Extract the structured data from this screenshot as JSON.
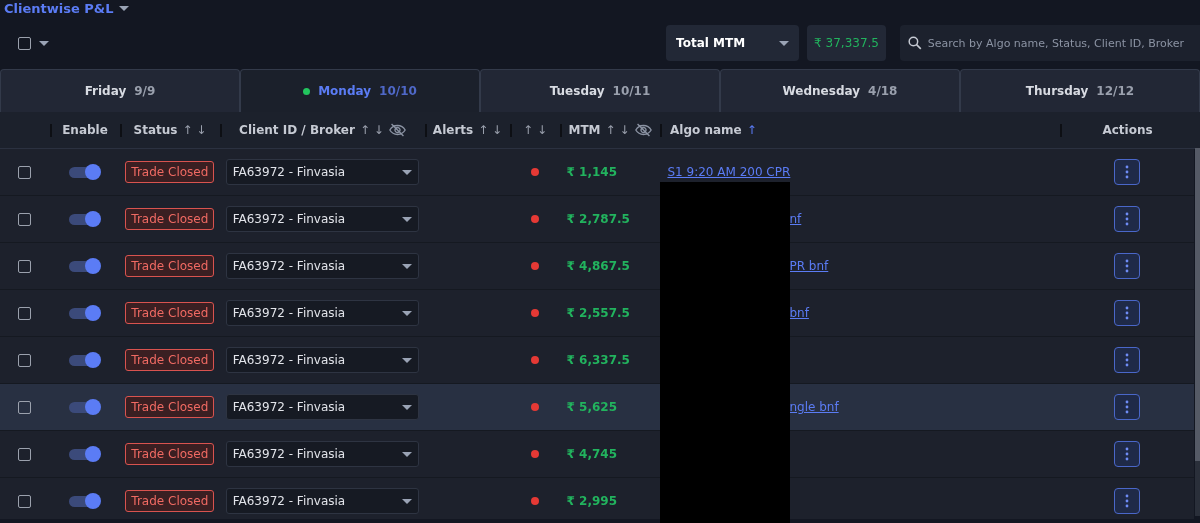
{
  "title": "Clientwise P&L",
  "select_all": {
    "checked": false
  },
  "metric_select": {
    "value": "Total MTM"
  },
  "total": "₹ 37,337.5",
  "search": {
    "placeholder": "Search by Algo name, Status, Client ID, Broker"
  },
  "tabs": [
    {
      "day": "Friday",
      "date": "9/9",
      "selected": false,
      "live": false
    },
    {
      "day": "Monday",
      "date": "10/10",
      "selected": true,
      "live": true
    },
    {
      "day": "Tuesday",
      "date": "10/11",
      "selected": false,
      "live": false
    },
    {
      "day": "Wednesday",
      "date": "4/18",
      "selected": false,
      "live": false
    },
    {
      "day": "Thursday",
      "date": "12/12",
      "selected": false,
      "live": false
    }
  ],
  "columns": [
    {
      "kind": "check"
    },
    {
      "kind": "text",
      "label": "Enable"
    },
    {
      "kind": "text",
      "label": "Status",
      "sort_arrows": "↑ ↓",
      "sorted": false
    },
    {
      "kind": "text",
      "label": "Client ID / Broker",
      "sort_arrows": "↑ ↓",
      "sorted": false,
      "hide_icon": true
    },
    {
      "kind": "text",
      "label": "Alerts",
      "sort_arrows": "↑ ↓",
      "sorted": false
    },
    {
      "kind": "text",
      "sort_arrows": "↑ ↓",
      "sorted": false
    },
    {
      "kind": "text",
      "label": "MTM",
      "sort_arrows": "↑ ↓",
      "sorted": false,
      "hide_icon": true
    },
    {
      "kind": "text",
      "label": "Algo name",
      "sort_arrows": "↑",
      "sorted": true
    },
    {
      "kind": "text",
      "label": "Actions"
    }
  ],
  "rows": [
    {
      "checked": false,
      "enabled": true,
      "status": "Trade Closed",
      "client": "FA63972 - Finvasia",
      "color": "#e53935",
      "mtm": "₹ 1,145",
      "algo": "S1 9:20 AM 200 CPR",
      "hovered": false
    },
    {
      "checked": false,
      "enabled": true,
      "status": "Trade Closed",
      "client": "FA63972 - Finvasia",
      "color": "#e53935",
      "mtm": "₹ 2,787.5",
      "algo_tail": "nf",
      "hovered": false
    },
    {
      "checked": false,
      "enabled": true,
      "status": "Trade Closed",
      "client": "FA63972 - Finvasia",
      "color": "#e53935",
      "mtm": "₹ 4,867.5",
      "algo_tail": "PR bnf",
      "hovered": false
    },
    {
      "checked": false,
      "enabled": true,
      "status": "Trade Closed",
      "client": "FA63972 - Finvasia",
      "color": "#e53935",
      "mtm": "₹ 2,557.5",
      "algo_tail": "bnf",
      "hovered": false
    },
    {
      "checked": false,
      "enabled": true,
      "status": "Trade Closed",
      "client": "FA63972 - Finvasia",
      "color": "#e53935",
      "mtm": "₹ 6,337.5",
      "hovered": false
    },
    {
      "checked": false,
      "enabled": true,
      "status": "Trade Closed",
      "client": "FA63972 - Finvasia",
      "color": "#e53935",
      "mtm": "₹ 5,625",
      "algo_tail": "ngle bnf",
      "hovered": true
    },
    {
      "checked": false,
      "enabled": true,
      "status": "Trade Closed",
      "client": "FA63972 - Finvasia",
      "color": "#e53935",
      "mtm": "₹ 4,745",
      "hovered": false
    },
    {
      "checked": false,
      "enabled": true,
      "status": "Trade Closed",
      "client": "FA63972 - Finvasia",
      "color": "#e53935",
      "mtm": "₹ 2,995",
      "hovered": false
    }
  ]
}
